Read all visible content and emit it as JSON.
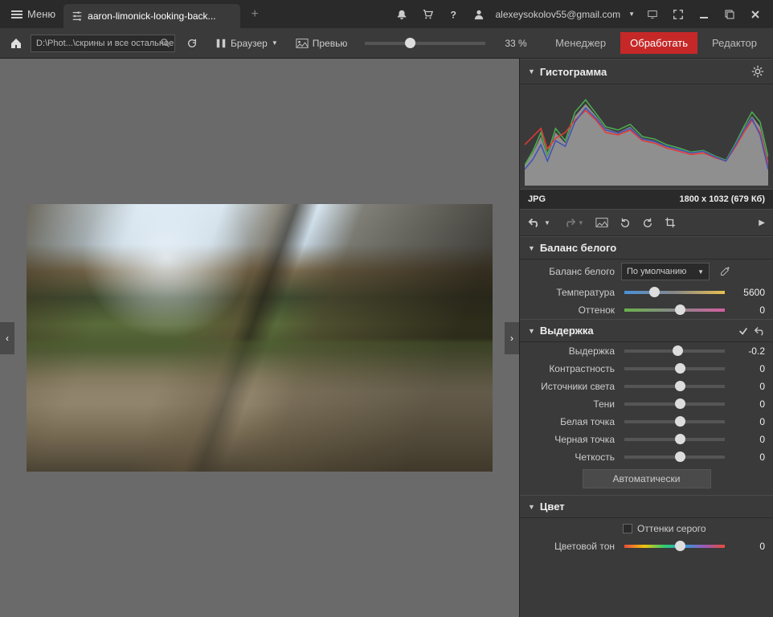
{
  "titlebar": {
    "menu_label": "Меню",
    "tab_title": "aaron-limonick-looking-back...",
    "user_email": "alexeysokolov55@gmail.com"
  },
  "toolbar": {
    "path_text": "D:\\Phot...\\скрины и все остальное",
    "browser_label": "Браузер",
    "preview_label": "Превью",
    "zoom_pct": "33 %",
    "mode_manager": "Менеджер",
    "mode_develop": "Обработать",
    "mode_editor": "Редактор"
  },
  "sidebar": {
    "histogram_title": "Гистограмма",
    "file_format": "JPG",
    "file_dims": "1800 x 1032 (679 Кб)",
    "wb": {
      "title": "Баланс белого",
      "preset_label": "Баланс белого",
      "preset_value": "По умолчанию",
      "temp_label": "Температура",
      "temp_value": "5600",
      "tint_label": "Оттенок",
      "tint_value": "0"
    },
    "exposure": {
      "title": "Выдержка",
      "exposure_label": "Выдержка",
      "exposure_value": "-0.2",
      "contrast_label": "Контрастность",
      "contrast_value": "0",
      "highlights_label": "Источники света",
      "highlights_value": "0",
      "shadows_label": "Тени",
      "shadows_value": "0",
      "whites_label": "Белая точка",
      "whites_value": "0",
      "blacks_label": "Черная точка",
      "blacks_value": "0",
      "clarity_label": "Четкость",
      "clarity_value": "0",
      "auto_label": "Автоматически"
    },
    "color": {
      "title": "Цвет",
      "grayscale_label": "Оттенки серого",
      "hue_label": "Цветовой тон",
      "hue_value": "0"
    }
  }
}
